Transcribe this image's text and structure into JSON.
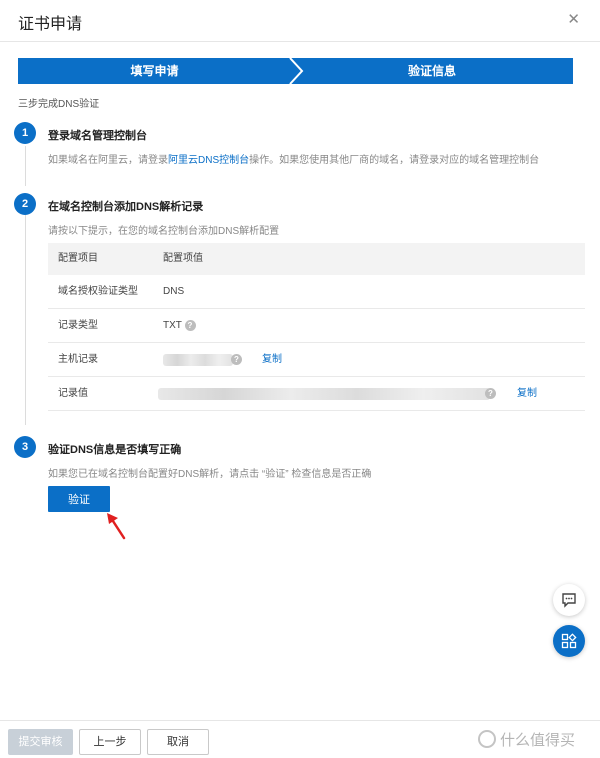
{
  "dialog": {
    "title": "证书申请",
    "close_icon": "close-icon"
  },
  "steps_bar": {
    "step1": "填写申请",
    "step2": "验证信息",
    "active_color": "#0b6fc7"
  },
  "subtitle": "三步完成DNS验证",
  "step1": {
    "number": "1",
    "title": "登录域名管理控制台",
    "desc_before": "如果域名在阿里云，请登录",
    "desc_link": "阿里云DNS控制台",
    "desc_after": "操作。如果您使用其他厂商的域名，请登录对应的域名管理控制台"
  },
  "step2": {
    "number": "2",
    "title": "在域名控制台添加DNS解析记录",
    "desc": "请按以下提示，在您的域名控制台添加DNS解析配置",
    "table": {
      "headers": [
        "配置项目",
        "配置项值"
      ],
      "rows": [
        {
          "label": "域名授权验证类型",
          "value": "DNS"
        },
        {
          "label": "记录类型",
          "value": "TXT"
        },
        {
          "label": "主机记录",
          "value": "",
          "copy": "复制"
        },
        {
          "label": "记录值",
          "value": "",
          "copy": "复制"
        }
      ]
    }
  },
  "step3": {
    "number": "3",
    "title": "验证DNS信息是否填写正确",
    "desc": "如果您已在域名控制台配置好DNS解析，请点击 “验证” 检查信息是否正确",
    "verify_button": "验证"
  },
  "footer": {
    "submit": "提交审核",
    "prev": "上一步",
    "cancel": "取消"
  },
  "watermark": "什么值得买"
}
